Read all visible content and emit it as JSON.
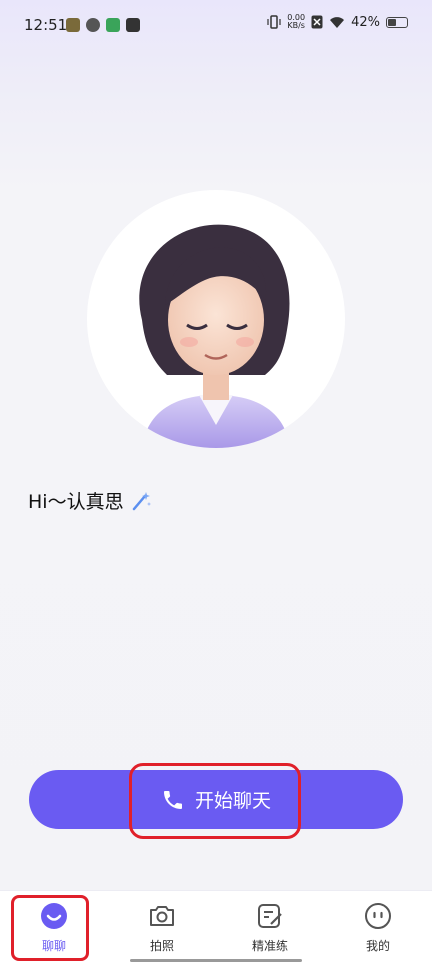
{
  "status_bar": {
    "time": "12:51",
    "speed_value": "0.00",
    "speed_unit": "KB/s",
    "battery_percent": "42%",
    "battery_level": 0.42
  },
  "greeting": {
    "text": "Hi～认真思"
  },
  "start_button": {
    "label": "开始聊天"
  },
  "bottom_nav": {
    "items": [
      {
        "label": "聊聊",
        "icon": "chat-face-icon",
        "active": true
      },
      {
        "label": "拍照",
        "icon": "camera-icon",
        "active": false
      },
      {
        "label": "精准练",
        "icon": "edit-note-icon",
        "active": false
      },
      {
        "label": "我的",
        "icon": "profile-face-icon",
        "active": false
      }
    ]
  },
  "colors": {
    "accent": "#6a5bf2",
    "highlight": "#e0202a"
  }
}
